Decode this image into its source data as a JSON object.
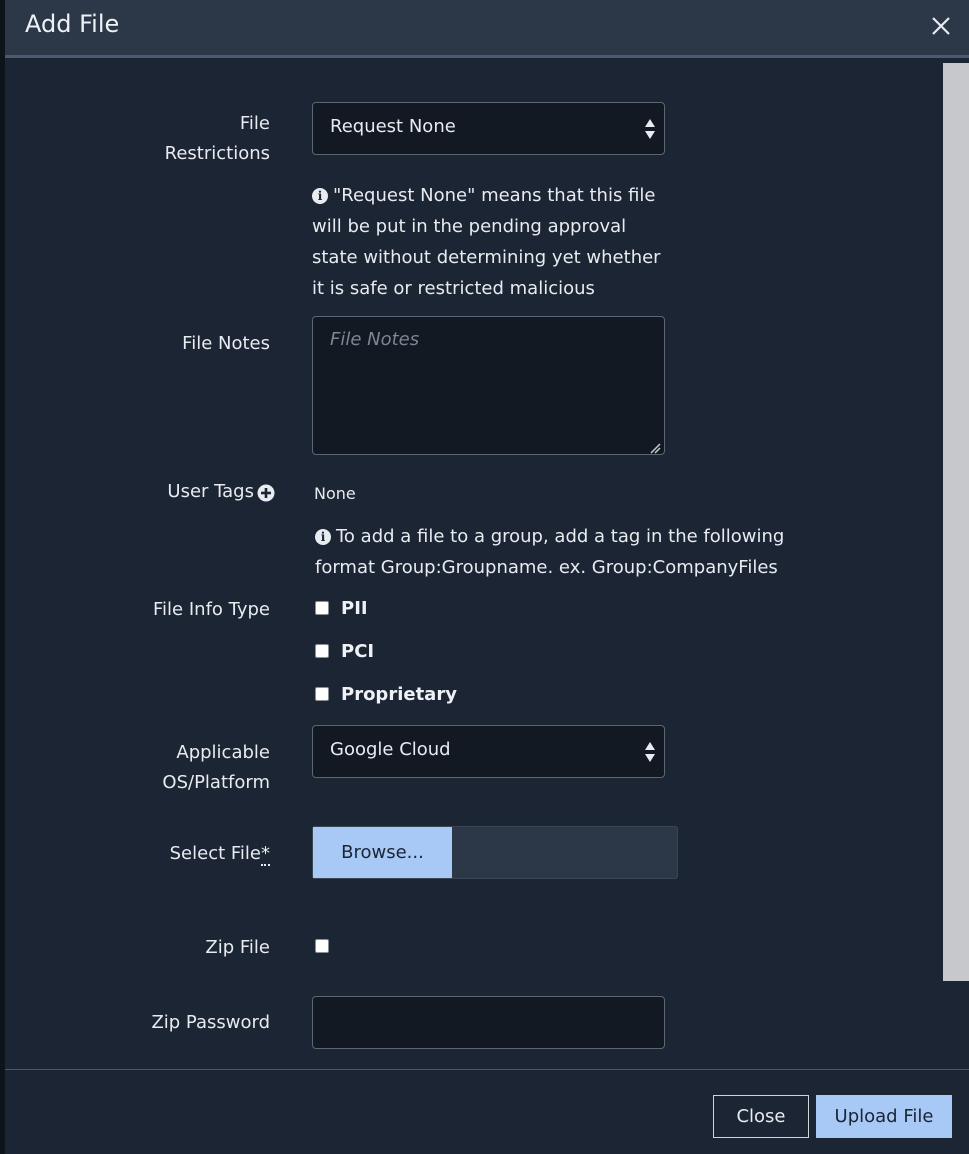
{
  "modal": {
    "title": "Add File",
    "close_icon": "close-icon"
  },
  "form": {
    "restrictions": {
      "label_line1": "File",
      "label_line2": "Restrictions",
      "value": "Request None",
      "help_line1": "\"Request None\" means that this file",
      "help_line2": "will be put in the pending approval",
      "help_line3": "state without determining yet whether",
      "help_line4": "it is safe or restricted malicious"
    },
    "notes": {
      "label": "File Notes",
      "placeholder": "File Notes"
    },
    "tags": {
      "label": "User Tags",
      "value": "None",
      "help_line1": "To add a file to a group, add a tag in the following",
      "help_line2": "format Group:Groupname. ex. Group:CompanyFiles"
    },
    "info_type": {
      "label": "File Info Type",
      "options": [
        "PII",
        "PCI",
        "Proprietary"
      ]
    },
    "platform": {
      "label_line1": "Applicable",
      "label_line2": "OS/Platform",
      "value": "Google Cloud"
    },
    "select_file": {
      "label": "Select File",
      "required_mark": "*",
      "browse_label": "Browse..."
    },
    "zip_file": {
      "label": "Zip File"
    },
    "zip_password": {
      "label": "Zip Password"
    }
  },
  "footer": {
    "close_label": "Close",
    "upload_label": "Upload File"
  },
  "colors": {
    "background": "#1c2533",
    "header": "#2c3848",
    "input_bg": "#121923",
    "primary_button": "#a8c8f5"
  }
}
